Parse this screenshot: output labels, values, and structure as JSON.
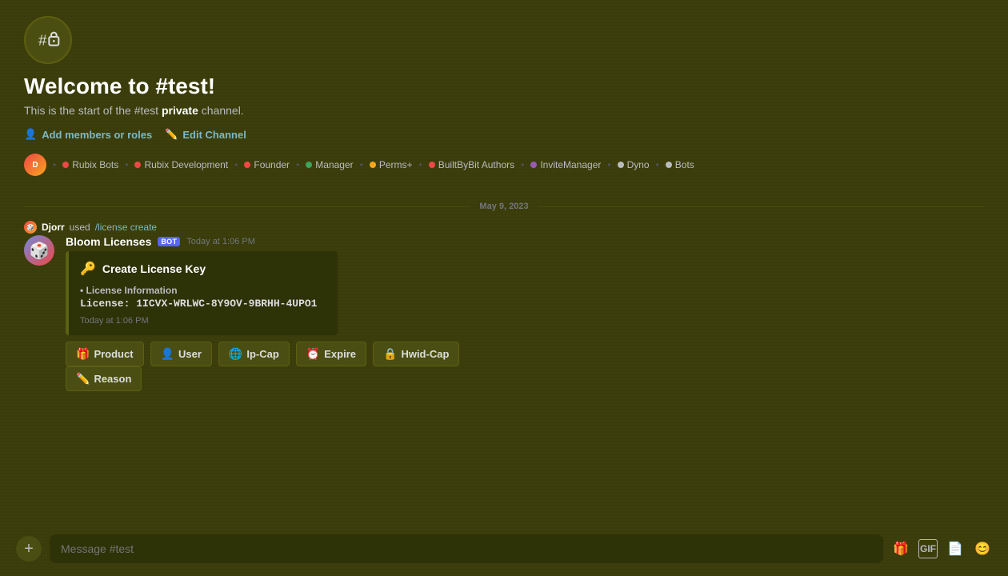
{
  "channel": {
    "icon_label": "#🔒",
    "title": "Welcome to #test!",
    "description_prefix": "This is the start of the #test ",
    "description_bold": "private",
    "description_suffix": " channel.",
    "add_members_label": "Add members or roles",
    "edit_channel_label": "Edit Channel"
  },
  "roles": [
    {
      "name": "Rubix Bots",
      "color": "#f04747"
    },
    {
      "name": "Rubix Development",
      "color": "#f04747"
    },
    {
      "name": "Founder",
      "color": "#f04747"
    },
    {
      "name": "Manager",
      "color": "#3ba55c"
    },
    {
      "name": "Perms+",
      "color": "#faa61a"
    },
    {
      "name": "BuiltByBit Authors",
      "color": "#f04747"
    },
    {
      "name": "InviteManager",
      "color": "#9b59b6"
    },
    {
      "name": "Dyno",
      "color": "#b9bbbe"
    },
    {
      "name": "Bots",
      "color": "#b9bbbe"
    }
  ],
  "date_divider": "May 9, 2023",
  "command_used": {
    "user": "Djorr",
    "command": "/license create"
  },
  "message": {
    "author": "Bloom Licenses",
    "bot_badge": "BOT",
    "timestamp": "Today at 1:06 PM",
    "embed": {
      "title": "Create License Key",
      "section_title": "• License Information",
      "license_label": "License:",
      "license_value": "1ICVX-WRLWC-8Y9OV-9BRHH-4UPO1",
      "footer": "Today at 1:06 PM"
    }
  },
  "action_buttons": [
    {
      "id": "product",
      "icon": "🎁",
      "label": "Product"
    },
    {
      "id": "user",
      "icon": "👤",
      "label": "User"
    },
    {
      "id": "ip-cap",
      "icon": "🌐",
      "label": "Ip-Cap"
    },
    {
      "id": "expire",
      "icon": "⏰",
      "label": "Expire"
    },
    {
      "id": "hwid-cap",
      "icon": "🔒",
      "label": "Hwid-Cap"
    },
    {
      "id": "reason",
      "icon": "✏️",
      "label": "Reason"
    }
  ],
  "message_input": {
    "placeholder": "Message #test"
  },
  "toolbar": {
    "gift_icon": "🎁",
    "gif_label": "GIF",
    "sticker_icon": "📄",
    "emoji_icon": "😊"
  }
}
